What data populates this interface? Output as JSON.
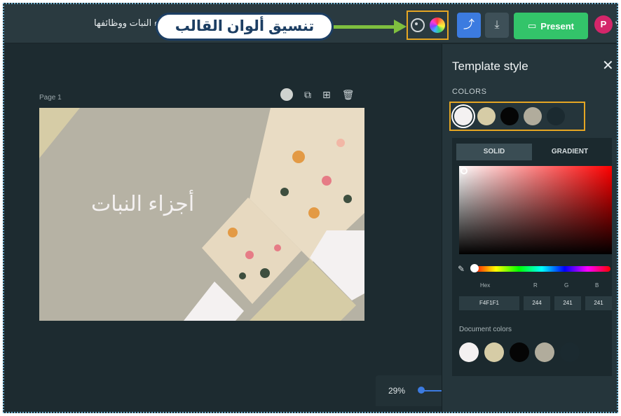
{
  "topbar": {
    "doc_title": "أجزاء النبات ووظائفها",
    "callout_text": "تنسيق ألوان القالب",
    "present_label": "Present",
    "avatar_initial": "P"
  },
  "canvas": {
    "page_label": "Page 1",
    "slide_title": "أجزاء النبات",
    "zoom": "29%"
  },
  "panel": {
    "title": "Template style",
    "colors_label": "COLORS",
    "theme_colors": [
      "#F4F1F1",
      "#D6CCA6",
      "#050505",
      "#B1AC9C",
      "#1B2A30"
    ],
    "tabs": [
      "SOLID",
      "GRADIENT"
    ],
    "field_labels": [
      "Hex",
      "R",
      "G",
      "B"
    ],
    "hex_value": "F4F1F1",
    "r": "244",
    "g": "241",
    "b": "241",
    "doc_colors_label": "Document colors",
    "doc_colors": [
      "#F4F1F1",
      "#D6CCA6",
      "#050505",
      "#B1AC9C",
      "#1B2A30"
    ]
  },
  "colors": {
    "accent_orange": "#E5A623",
    "share_blue": "#3C7BE0",
    "present_green": "#33C46A"
  }
}
